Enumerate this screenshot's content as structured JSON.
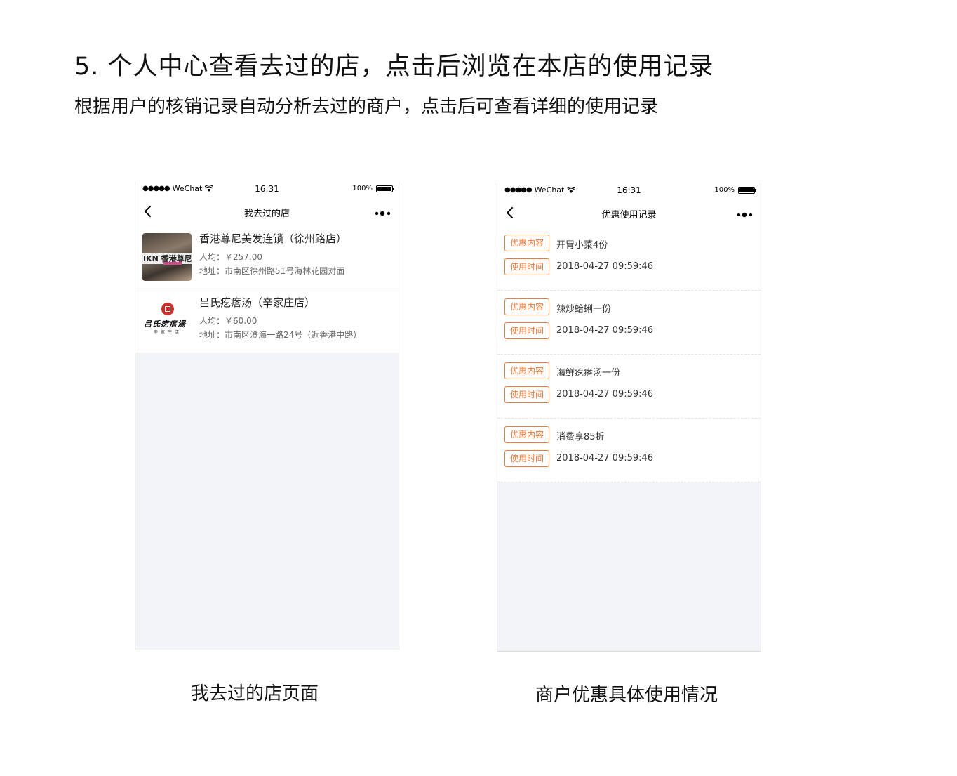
{
  "header": {
    "title": "5. 个人中心查看去过的店，点击后浏览在本店的使用记录",
    "subtitle": "根据用户的核销记录自动分析去过的商户，点击后可查看详细的使用记录"
  },
  "phone_left": {
    "statusbar": {
      "signal": "●●●●●",
      "carrier": "WeChat",
      "time": "16:31",
      "battery": "100%"
    },
    "nav": {
      "title": "我去过的店",
      "back_icon": "chevron-left-icon",
      "more_icon": "more-dots-icon"
    },
    "shops": [
      {
        "name": "香港尊尼美发连锁（徐州路店）",
        "avg": "人均：￥257.00",
        "address": "地址：市南区徐州路51号海林花园对面",
        "thumb_text": "IKN 香港尊尼"
      },
      {
        "name": "吕氏疙瘩汤（辛家庄店）",
        "avg": "人均：￥60.00",
        "address": "地址：市南区澄海一路24号（近香港中路）",
        "thumb_text": "吕氏疙瘩湯",
        "thumb_sub": "辛家庄店"
      }
    ],
    "caption": "我去过的店页面"
  },
  "phone_right": {
    "statusbar": {
      "signal": "●●●●●",
      "carrier": "WeChat",
      "time": "16:31",
      "battery": "100%"
    },
    "nav": {
      "title": "优惠使用记录",
      "back_icon": "chevron-left-icon",
      "more_icon": "more-dots-icon"
    },
    "tag_content": "优惠内容",
    "tag_time": "使用时间",
    "records": [
      {
        "content": "开胃小菜4份",
        "time": "2018-04-27 09:59:46"
      },
      {
        "content": "辣炒蛤蜊一份",
        "time": "2018-04-27 09:59:46"
      },
      {
        "content": "海鲜疙瘩汤一份",
        "time": "2018-04-27 09:59:46"
      },
      {
        "content": "消费享85折",
        "time": "2018-04-27 09:59:46"
      }
    ],
    "caption": "商户优惠具体使用情况"
  },
  "colors": {
    "accent": "#f07a3a",
    "background": "#f2f4f7"
  }
}
